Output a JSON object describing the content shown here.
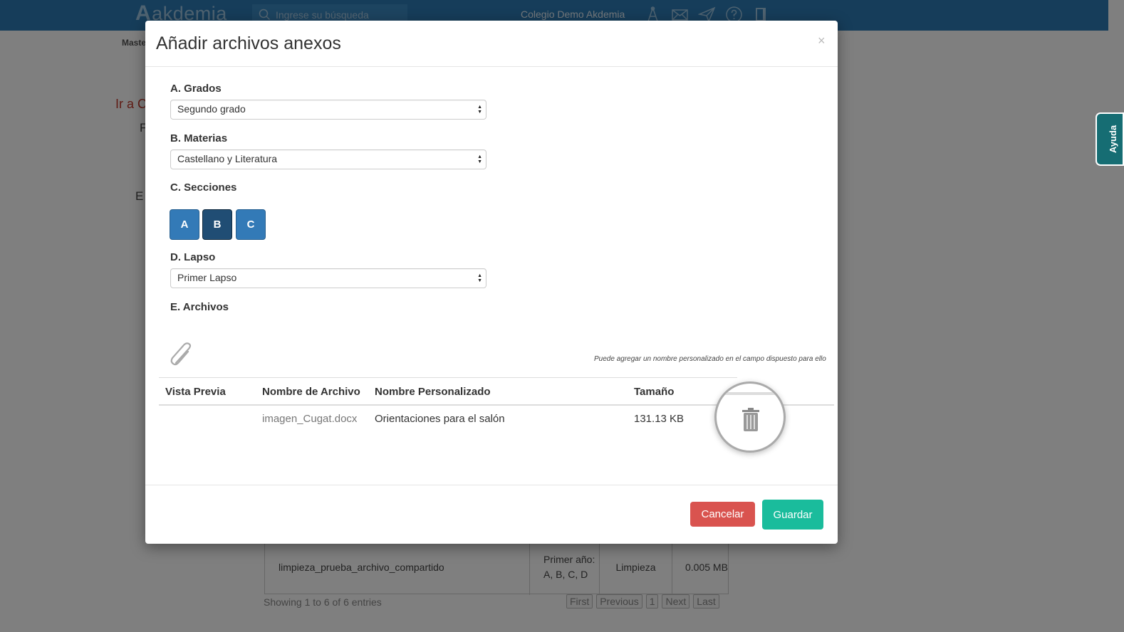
{
  "app": {
    "logo_text": "akdemia",
    "logo_mark": "A",
    "search_placeholder": "Ingrese su búsqueda",
    "school_name": "Colegio Demo Akdemia",
    "help_label": "Ayuda"
  },
  "background": {
    "breadcrumb": "Maste",
    "link_text": "Ir a C",
    "letter_f": "F",
    "letter_e": "E",
    "table_row": {
      "name": "limpieza_prueba_archivo_compartido",
      "grade": "Primer año: A, B, C, D",
      "subject": "Limpieza",
      "size": "0.005 MB"
    },
    "entries_info": "Showing 1 to 6 of 6 entries",
    "pager": [
      "First",
      "Previous",
      "1",
      "Next",
      "Last"
    ]
  },
  "modal": {
    "title": "Añadir archivos anexos",
    "close_symbol": "×",
    "grados_label": "A. Grados",
    "grados_value": "Segundo grado",
    "materias_label": "B. Materias",
    "materias_value": "Castellano y Literatura",
    "secciones_label": "C. Secciones",
    "sections": [
      "A",
      "B",
      "C"
    ],
    "active_section": "B",
    "lapso_label": "D. Lapso",
    "lapso_value": "Primer Lapso",
    "archivos_label": "E. Archivos",
    "hint": "Puede agregar un nombre personalizado en el campo dispuesto para ello",
    "table": {
      "headers": [
        "Vista Previa",
        "Nombre de Archivo",
        "Nombre Personalizado",
        "Tamaño"
      ],
      "rows": [
        {
          "preview": "",
          "file_name": "imagen_Cugat.docx",
          "custom_name": "Orientaciones para el salón",
          "size": "131.13 KB"
        }
      ]
    },
    "cancel_label": "Cancelar",
    "save_label": "Guardar"
  },
  "colors": {
    "topbar": "#2c7bb4",
    "section_button": "#337ab7",
    "section_button_active": "#204d74",
    "cancel": "#d9534f",
    "save": "#1abc9c",
    "help_tab": "#166d73"
  }
}
